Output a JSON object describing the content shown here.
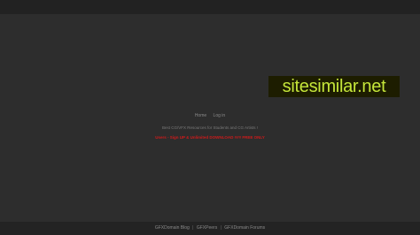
{
  "nav": {
    "home_label": "Home",
    "login_label": "Log in"
  },
  "tagline": "Best CG/VFX Resources for Students and CG Artists !",
  "alert": "Users - Sign UP & Unlimited DOWNLOAD ### FREE ONLY",
  "watermark": "sitesimilar.net",
  "footer": {
    "links": [
      "GFXDomain Blog",
      "GFXPeers",
      "GFXDomain Forums"
    ],
    "separator": "|"
  },
  "colors": {
    "background": "#2d2d2d",
    "watermark_text": "#c5e63a",
    "alert_text": "#d11a1a"
  }
}
